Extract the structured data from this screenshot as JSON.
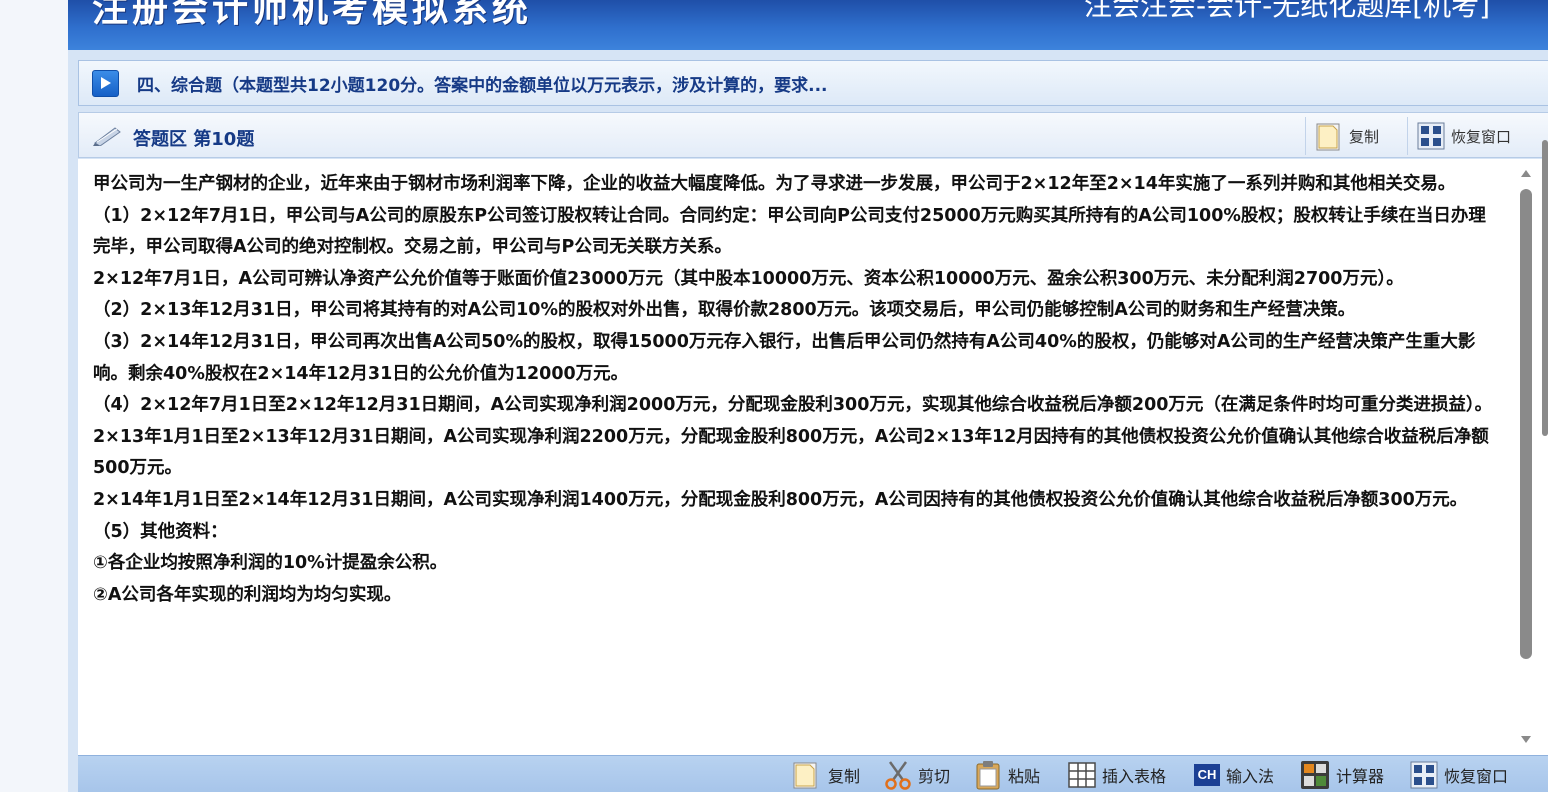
{
  "banner": {
    "title": "注册会计师机考模拟系统",
    "right_text": "注会注会-会计-无纸化题库[机考]"
  },
  "section": {
    "text": "四、综合题（本题型共12小题120分。答案中的金额单位以万元表示，涉及计算的，要求..."
  },
  "answer_area": {
    "title": "答题区 第10题",
    "copy_label": "复制",
    "restore_label": "恢复窗口"
  },
  "question": {
    "paragraphs": [
      "甲公司为一生产钢材的企业，近年来由于钢材市场利润率下降，企业的收益大幅度降低。为了寻求进一步发展，甲公司于2×12年至2×14年实施了一系列并购和其他相关交易。",
      "（1）2×12年7月1日，甲公司与A公司的原股东P公司签订股权转让合同。合同约定：甲公司向P公司支付25000万元购买其所持有的A公司100%股权；股权转让手续在当日办理完毕，甲公司取得A公司的绝对控制权。交易之前，甲公司与P公司无关联方关系。",
      "2×12年7月1日，A公司可辨认净资产公允价值等于账面价值23000万元（其中股本10000万元、资本公积10000万元、盈余公积300万元、未分配利润2700万元）。",
      "（2）2×13年12月31日，甲公司将其持有的对A公司10%的股权对外出售，取得价款2800万元。该项交易后，甲公司仍能够控制A公司的财务和生产经营决策。",
      "（3）2×14年12月31日，甲公司再次出售A公司50%的股权，取得15000万元存入银行，出售后甲公司仍然持有A公司40%的股权，仍能够对A公司的生产经营决策产生重大影响。剩余40%股权在2×14年12月31日的公允价值为12000万元。",
      "（4）2×12年7月1日至2×12年12月31日期间，A公司实现净利润2000万元，分配现金股利300万元，实现其他综合收益税后净额200万元（在满足条件时均可重分类进损益）。",
      "2×13年1月1日至2×13年12月31日期间，A公司实现净利润2200万元，分配现金股利800万元，A公司2×13年12月因持有的其他债权投资公允价值确认其他综合收益税后净额500万元。",
      "2×14年1月1日至2×14年12月31日期间，A公司实现净利润1400万元，分配现金股利800万元，A公司因持有的其他债权投资公允价值确认其他综合收益税后净额300万元。",
      "（5）其他资料：",
      "①各企业均按照净利润的10%计提盈余公积。",
      "②A公司各年实现的利润均为均匀实现。"
    ]
  },
  "toolbar": {
    "copy": "复制",
    "cut": "剪切",
    "paste": "粘贴",
    "insert_table": "插入表格",
    "ime_badge": "CH",
    "ime": "输入法",
    "calculator": "计算器",
    "restore": "恢复窗口"
  }
}
